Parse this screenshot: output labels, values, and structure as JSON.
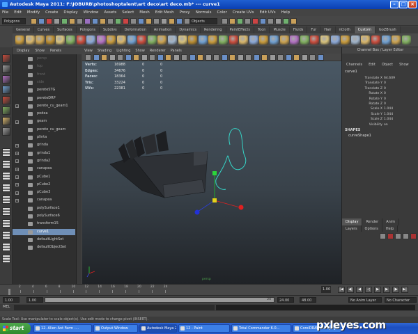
{
  "window": {
    "title": "Autodesk Maya 2011: F:\\JOBURB\\photoshoptalent\\art deco\\art deco.mb*  ---  curve1"
  },
  "menu": [
    "File",
    "Edit",
    "Modify",
    "Create",
    "Display",
    "Window",
    "Assets",
    "Select",
    "Mesh",
    "Edit Mesh",
    "Proxy",
    "Normals",
    "Color",
    "Create UVs",
    "Edit UVs",
    "Help"
  ],
  "status": {
    "mode": "Polygons",
    "objects_field": "Objects"
  },
  "shelf_tabs": [
    "General",
    "Curves",
    "Surfaces",
    "Polygons",
    "Subdivs",
    "Deformation",
    "Animation",
    "Dynamics",
    "Rendering",
    "PaintEffects",
    "Toon",
    "Muscle",
    "Fluids",
    "Fur",
    "Hair",
    "nCloth",
    "Custom",
    "GoZBrush"
  ],
  "shelf_active": "Custom",
  "outliner": {
    "menu": [
      "Display",
      "Show",
      "Panels"
    ],
    "items": [
      {
        "label": "persp",
        "dim": true
      },
      {
        "label": "top",
        "dim": true
      },
      {
        "label": "front",
        "dim": true
      },
      {
        "label": "side",
        "dim": true
      },
      {
        "label": "pereteSTG"
      },
      {
        "label": "pereteDRP"
      },
      {
        "label": "perete_cu_geam1"
      },
      {
        "label": "podea"
      },
      {
        "label": "geam"
      },
      {
        "label": "perete_cu_geam"
      },
      {
        "label": "plinta"
      },
      {
        "label": "grinda"
      },
      {
        "label": "grinda1"
      },
      {
        "label": "grinda2"
      },
      {
        "label": "canapea"
      },
      {
        "label": "pCube1"
      },
      {
        "label": "pCube2"
      },
      {
        "label": "pCube3"
      },
      {
        "label": "canapea"
      },
      {
        "label": "polySurface1"
      },
      {
        "label": "polySurface6"
      },
      {
        "label": "transform15"
      },
      {
        "label": "curve1",
        "selected": true
      },
      {
        "label": "defaultLightSet"
      },
      {
        "label": "defaultObjectSet"
      }
    ]
  },
  "viewport": {
    "menu": [
      "View",
      "Shading",
      "Lighting",
      "Show",
      "Renderer",
      "Panels"
    ],
    "hud": [
      {
        "label": "Verts:",
        "a": "16988",
        "b": "0",
        "c": "0"
      },
      {
        "label": "Edges:",
        "a": "34676",
        "b": "0",
        "c": "0"
      },
      {
        "label": "Faces:",
        "a": "18364",
        "b": "0",
        "c": "0"
      },
      {
        "label": "Tris:",
        "a": "33224",
        "b": "0",
        "c": "0"
      },
      {
        "label": "UVs:",
        "a": "22381",
        "b": "0",
        "c": "0"
      }
    ],
    "camera": "persp"
  },
  "channel_box": {
    "title": "Channel Box / Layer Editor",
    "menu": [
      "Channels",
      "Edit",
      "Object",
      "Show"
    ],
    "object": "curve1",
    "channels": [
      {
        "label": "Translate X",
        "value": "64.609"
      },
      {
        "label": "Translate Y",
        "value": "0"
      },
      {
        "label": "Translate Z",
        "value": "0"
      },
      {
        "label": "Rotate X",
        "value": "0"
      },
      {
        "label": "Rotate Y",
        "value": "0"
      },
      {
        "label": "Rotate Z",
        "value": "0"
      },
      {
        "label": "Scale X",
        "value": "1.044"
      },
      {
        "label": "Scale Y",
        "value": "1.044"
      },
      {
        "label": "Scale Z",
        "value": "1.044"
      },
      {
        "label": "Visibility",
        "value": "on"
      }
    ],
    "shapes_header": "SHAPES",
    "shape": "curveShape1",
    "layer_tabs": [
      "Display",
      "Render",
      "Anim"
    ],
    "layer_menu": [
      "Layers",
      "Options",
      "Help"
    ]
  },
  "timeline": {
    "ticks": [
      "2",
      "4",
      "6",
      "8",
      "10",
      "12",
      "14",
      "16",
      "18",
      "20",
      "22",
      "24"
    ],
    "current": "1.00",
    "range_start": "1.00",
    "range_inner_start": "1.00",
    "range_inner_end": "24",
    "range_end": "24.00",
    "range_end2": "48.00",
    "anim_layer": "No Anim Layer",
    "char_set": "No Character Set"
  },
  "cmd": {
    "label": "MEL"
  },
  "help_text": "Scale Tool: Use manipulator to scale object(s). Use edit mode to change pivot (INSERT).",
  "taskbar": {
    "start": "start",
    "tasks": [
      "12. Alien Ant Farm -...",
      "Output Window",
      "Autodesk Maya 2011...",
      "12 - Paint",
      "Total Commander 6.0...",
      "CorelDRAW X3 - [F:\\J..."
    ]
  },
  "watermark": "pxleyes.com",
  "colors": {
    "selected": "#6f8fb7",
    "curve": "#36d6c8",
    "accent": "#1f5fd1"
  }
}
